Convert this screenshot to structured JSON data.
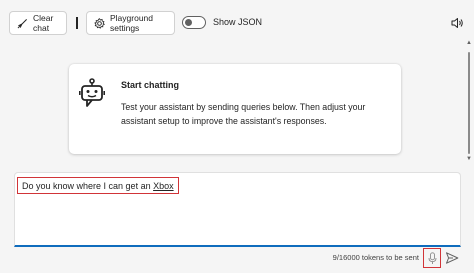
{
  "toolbar": {
    "clear_label": "Clear chat",
    "settings_label": "Playground settings",
    "json_toggle_label": "Show JSON",
    "json_toggle_on": false
  },
  "welcome": {
    "title": "Start chatting",
    "body": "Test your assistant by sending queries below. Then adjust your assistant setup to improve the assistant's responses."
  },
  "composer": {
    "text_prefix": "Do you know where I can get an ",
    "text_link": "Xbox",
    "token_count": "9/16000 tokens to be sent"
  },
  "icons": {
    "clear": "broom-icon",
    "settings": "settings-icon",
    "speaker": "speaker-icon",
    "bot": "bot-icon",
    "mic": "microphone-icon",
    "send": "send-icon"
  },
  "colors": {
    "accent": "#0f6cbd",
    "highlight": "#d13438"
  }
}
